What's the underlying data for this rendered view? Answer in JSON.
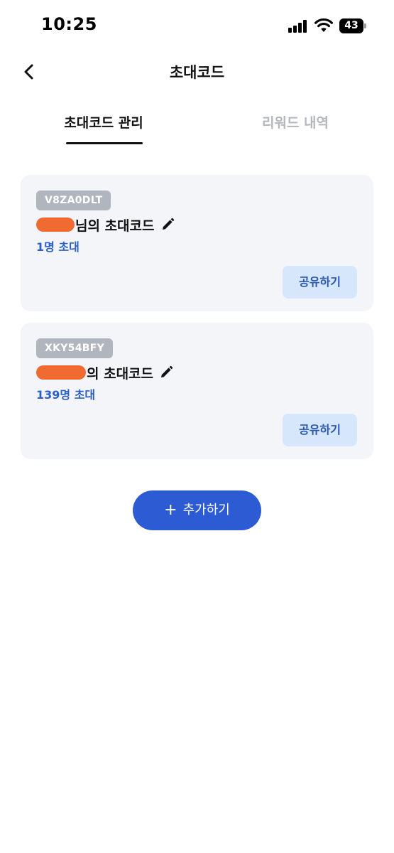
{
  "status_bar": {
    "time": "10:25",
    "battery_level": "43",
    "icons": [
      "cellular-signal-icon",
      "wifi-icon",
      "battery-icon"
    ]
  },
  "header": {
    "title": "초대코드",
    "back_icon": "chevron-left-icon"
  },
  "tabs": [
    {
      "label": "초대코드 관리",
      "active": true
    },
    {
      "label": "리워드 내역",
      "active": false
    }
  ],
  "cards": [
    {
      "code": "V8ZA0DLT",
      "owner_suffix": "님의 초대코드",
      "invite_count": "1명 초대",
      "share_label": "공유하기",
      "edit_icon": "pencil-icon"
    },
    {
      "code": "XKY54BFY",
      "owner_suffix": "의 초대코드",
      "invite_count": "139명 초대",
      "share_label": "공유하기",
      "edit_icon": "pencil-icon"
    }
  ],
  "add_button": {
    "label": "추가하기",
    "icon": "plus-icon"
  },
  "colors": {
    "accent_blue": "#2d5bd4",
    "invite_count_blue": "#2b60c8",
    "share_button_bg": "#d7e7fb",
    "badge_gray": "#b1b5bd",
    "card_bg": "#f4f5f8",
    "inactive_tab": "#b3b6bd",
    "redaction_orange": "#f06a32"
  }
}
